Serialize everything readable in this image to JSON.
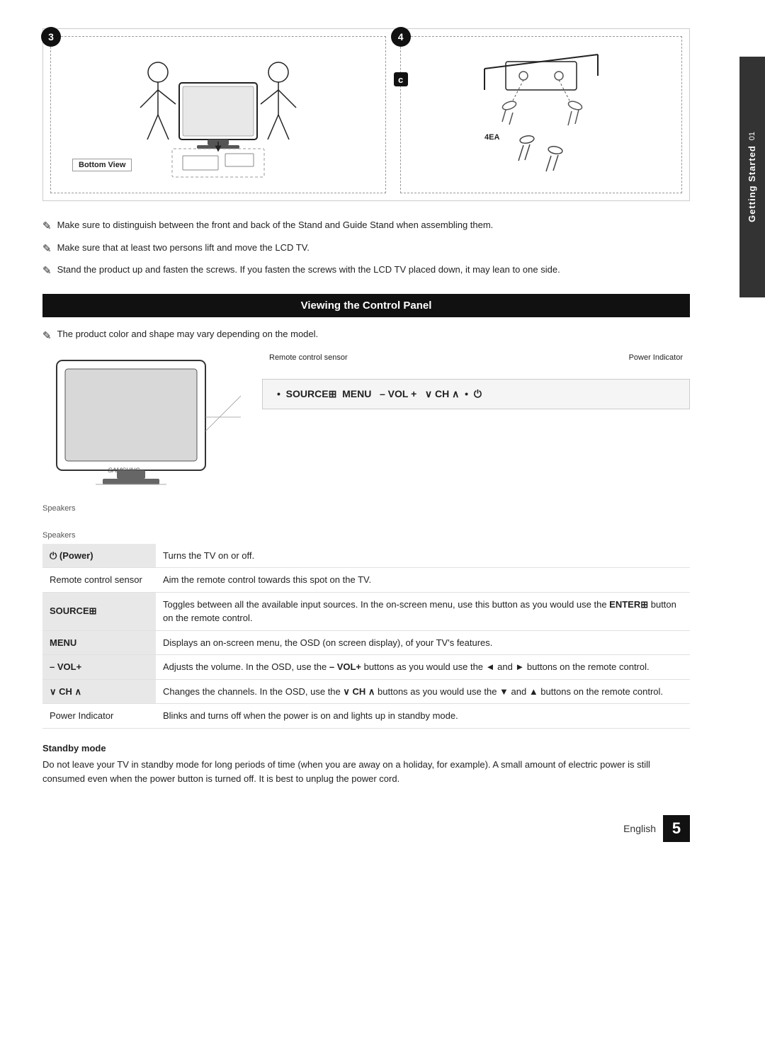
{
  "side_tab": {
    "number": "01",
    "text": "Getting Started"
  },
  "notes": [
    "Make sure to distinguish between the front and back of the Stand and Guide Stand when assembling them.",
    "Make sure that at least two persons lift and move the LCD TV.",
    "Stand the product up and fasten the screws. If you fasten the screws with the LCD TV placed down, it may lean to one side."
  ],
  "section_header": "Viewing the Control Panel",
  "product_note": "The product color and shape may vary depending on the model.",
  "diagram": {
    "remote_sensor_label": "Remote control sensor",
    "power_indicator_label": "Power Indicator",
    "speakers_label": "Speakers"
  },
  "controls_bar": "• SOURCE  MENU  – VOL +  ∨ CH ∧  •  ⏻",
  "bottom_view_label": "Bottom View",
  "step3_badge": "3",
  "step4_badge": "4",
  "c_label": "c",
  "ea_label": "4EA",
  "functions": [
    {
      "label": "⏻ (Power)",
      "description": "Turns the TV on or off.",
      "has_bg": true
    },
    {
      "label": "Remote control sensor",
      "description": "Aim the remote control towards this spot on the TV.",
      "has_bg": false
    },
    {
      "label": "SOURCE",
      "description": "Toggles between all the available input sources. In the on-screen menu, use this button as you would use the ENTER  button on the remote control.",
      "has_bg": true
    },
    {
      "label": "MENU",
      "description": "Displays an on-screen menu, the OSD (on screen display), of your TV's features.",
      "has_bg": true
    },
    {
      "label": "– VOL+",
      "description": "Adjusts the volume. In the OSD, use the – VOL+ buttons as you would use the ◄ and ► buttons on the remote control.",
      "has_bg": true
    },
    {
      "label": "∨ CH ∧",
      "description": "Changes the channels. In the OSD, use the ∨ CH ∧ buttons as you would use the ▼ and ▲ buttons on the remote control.",
      "has_bg": true
    },
    {
      "label": "Power Indicator",
      "description": "Blinks and turns off when the power is on and lights up in standby mode.",
      "has_bg": false
    }
  ],
  "standby": {
    "title": "Standby mode",
    "text": "Do not leave your TV in standby mode for long periods of time (when you are away on a holiday, for example). A small amount of electric power is still consumed even when the power button is turned off. It is best to unplug the power cord."
  },
  "footer": {
    "language": "English",
    "page_number": "5"
  }
}
